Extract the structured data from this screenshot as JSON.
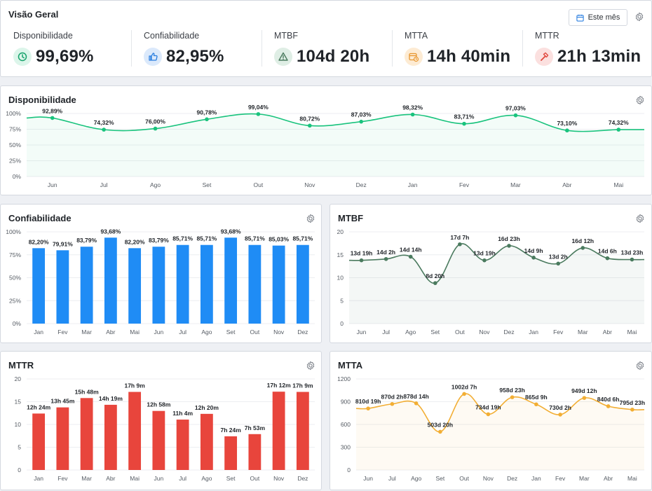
{
  "overview": {
    "title": "Visão Geral",
    "period_label": "Este mês",
    "kpis": [
      {
        "label": "Disponibilidade",
        "value": "99,69%",
        "icon": "clock-icon",
        "bg": "#dcf5ea",
        "fg": "#16a36b"
      },
      {
        "label": "Confiabilidade",
        "value": "82,95%",
        "icon": "thumbs-up-icon",
        "bg": "#dbe9fb",
        "fg": "#2b7fe0"
      },
      {
        "label": "MTBF",
        "value": "104d 20h",
        "icon": "warning-icon",
        "bg": "#dfeee5",
        "fg": "#4a7a5e"
      },
      {
        "label": "MTTA",
        "value": "14h 40min",
        "icon": "calendar-clock-icon",
        "bg": "#fdebd3",
        "fg": "#e8962e"
      },
      {
        "label": "MTTR",
        "value": "21h 13min",
        "icon": "hammer-icon",
        "bg": "#fbe0df",
        "fg": "#e0463c"
      }
    ]
  },
  "colors": {
    "green": "#19c37d",
    "blue": "#1f8cf5",
    "teal": "#4a7a5e",
    "red": "#e8453c",
    "orange": "#f2ae34"
  },
  "chart_data": [
    {
      "id": "disponibilidade",
      "title": "Disponibilidade",
      "type": "line",
      "categories": [
        "Jun",
        "Jul",
        "Ago",
        "Set",
        "Out",
        "Nov",
        "Dez",
        "Jan",
        "Fev",
        "Mar",
        "Abr",
        "Mai"
      ],
      "values": [
        92.89,
        74.32,
        76.0,
        90.78,
        99.04,
        80.72,
        87.03,
        98.32,
        83.71,
        97.03,
        73.1,
        74.32
      ],
      "labels": [
        "92,89%",
        "74,32%",
        "76,00%",
        "90,78%",
        "99,04%",
        "80,72%",
        "87,03%",
        "98,32%",
        "83,71%",
        "97,03%",
        "73,10%",
        "74,32%"
      ],
      "yticks": [
        "100%",
        "75%",
        "50%",
        "25%",
        "0%"
      ],
      "ylim": [
        0,
        100
      ]
    },
    {
      "id": "confiabilidade",
      "title": "Confiabilidade",
      "type": "bar",
      "categories": [
        "Jan",
        "Fev",
        "Mar",
        "Abr",
        "Mai",
        "Jun",
        "Jul",
        "Ago",
        "Set",
        "Out",
        "Nov",
        "Dez"
      ],
      "values": [
        82.2,
        79.91,
        83.79,
        93.68,
        82.2,
        83.79,
        85.71,
        85.71,
        93.68,
        85.71,
        85.03,
        85.71
      ],
      "labels": [
        "82,20%",
        "79,91%",
        "83,79%",
        "93,68%",
        "82,20%",
        "83,79%",
        "85,71%",
        "85,71%",
        "93,68%",
        "85,71%",
        "85,03%",
        "85,71%"
      ],
      "yticks": [
        "100%",
        "75%",
        "50%",
        "25%",
        "0%"
      ],
      "ylim": [
        0,
        100
      ]
    },
    {
      "id": "mtbf",
      "title": "MTBF",
      "type": "line",
      "categories": [
        "Jun",
        "Jul",
        "Ago",
        "Set",
        "Out",
        "Nov",
        "Dez",
        "Jan",
        "Fev",
        "Mar",
        "Abr",
        "Mai"
      ],
      "values": [
        13.79,
        14.08,
        14.58,
        8.83,
        17.29,
        13.79,
        16.96,
        14.38,
        13.08,
        16.5,
        14.25,
        13.96
      ],
      "labels": [
        "13d 19h",
        "14d 2h",
        "14d 14h",
        "8d 20h",
        "17d 7h",
        "13d 19h",
        "16d 23h",
        "14d 9h",
        "13d 2h",
        "16d 12h",
        "14d 6h",
        "13d 23h"
      ],
      "yticks": [
        "20",
        "15",
        "10",
        "5",
        "0"
      ],
      "ylim": [
        0,
        20
      ]
    },
    {
      "id": "mttr",
      "title": "MTTR",
      "type": "bar",
      "categories": [
        "Jan",
        "Fev",
        "Mar",
        "Abr",
        "Mai",
        "Jun",
        "Jul",
        "Ago",
        "Set",
        "Out",
        "Nov",
        "Dez"
      ],
      "values": [
        12.4,
        13.75,
        15.8,
        14.32,
        17.15,
        12.97,
        11.07,
        12.33,
        7.4,
        7.88,
        17.2,
        17.15
      ],
      "labels": [
        "12h 24m",
        "13h 45m",
        "15h 48m",
        "14h 19m",
        "17h 9m",
        "12h 58m",
        "11h 4m",
        "12h 20m",
        "7h 24m",
        "7h 53m",
        "17h 12m",
        "17h 9m"
      ],
      "yticks": [
        "20",
        "15",
        "10",
        "5",
        "0"
      ],
      "ylim": [
        0,
        20
      ]
    },
    {
      "id": "mtta",
      "title": "MTTA",
      "type": "line",
      "categories": [
        "Jun",
        "Jul",
        "Ago",
        "Set",
        "Out",
        "Nov",
        "Dez",
        "Jan",
        "Fev",
        "Mar",
        "Abr",
        "Mai"
      ],
      "values": [
        810.8,
        870.1,
        878.6,
        503.8,
        1002.3,
        734.8,
        958.96,
        865.4,
        730.1,
        949.5,
        840.25,
        795.96
      ],
      "labels": [
        "810d 19h",
        "870d 2h",
        "878d 14h",
        "503d 20h",
        "1002d 7h",
        "734d 19h",
        "958d 23h",
        "865d 9h",
        "730d 2h",
        "949d 12h",
        "840d 6h",
        "795d 23h"
      ],
      "yticks": [
        "1200",
        "900",
        "600",
        "300",
        "0"
      ],
      "ylim": [
        0,
        1200
      ]
    }
  ]
}
